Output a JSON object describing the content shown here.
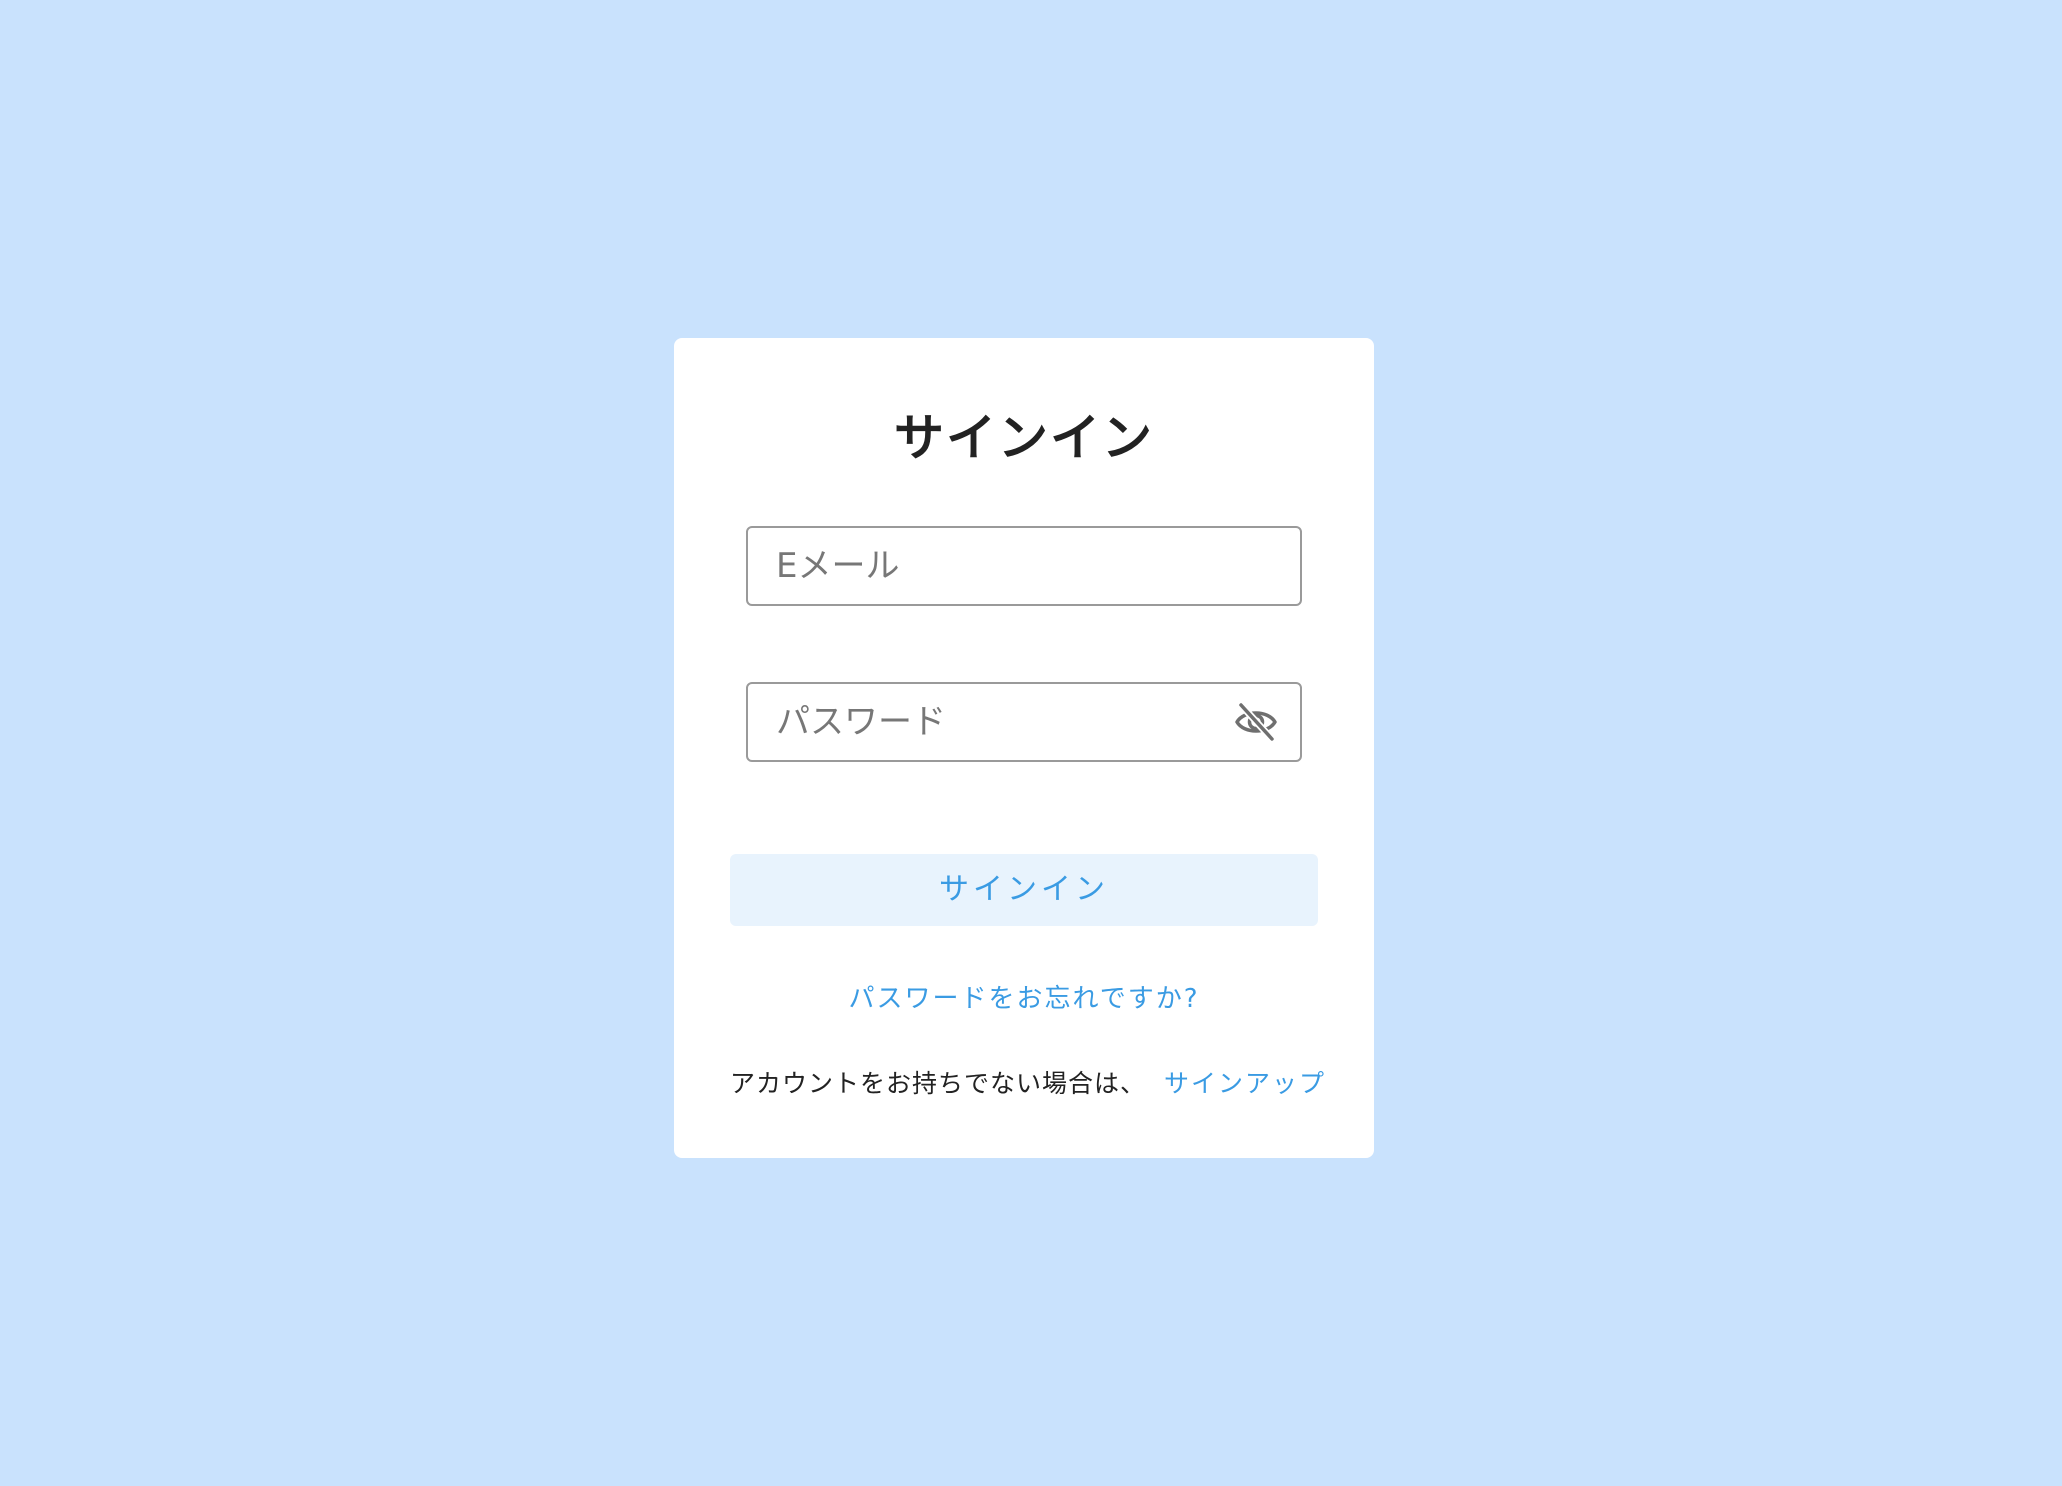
{
  "signin_card": {
    "title": "サインイン",
    "email": {
      "placeholder": "Eメール",
      "value": ""
    },
    "password": {
      "placeholder": "パスワード",
      "value": "",
      "toggle_icon": "eye-off-icon"
    },
    "submit_label": "サインイン",
    "forgot_link": "パスワードをお忘れですか?",
    "no_account_text": "アカウントをお持ちでない場合は、",
    "signup_link": "サインアップ"
  },
  "colors": {
    "background": "#c9e2fd",
    "card": "#ffffff",
    "accent": "#3a9be3",
    "button_bg": "#e8f3fd",
    "border": "#9a9a9a"
  }
}
